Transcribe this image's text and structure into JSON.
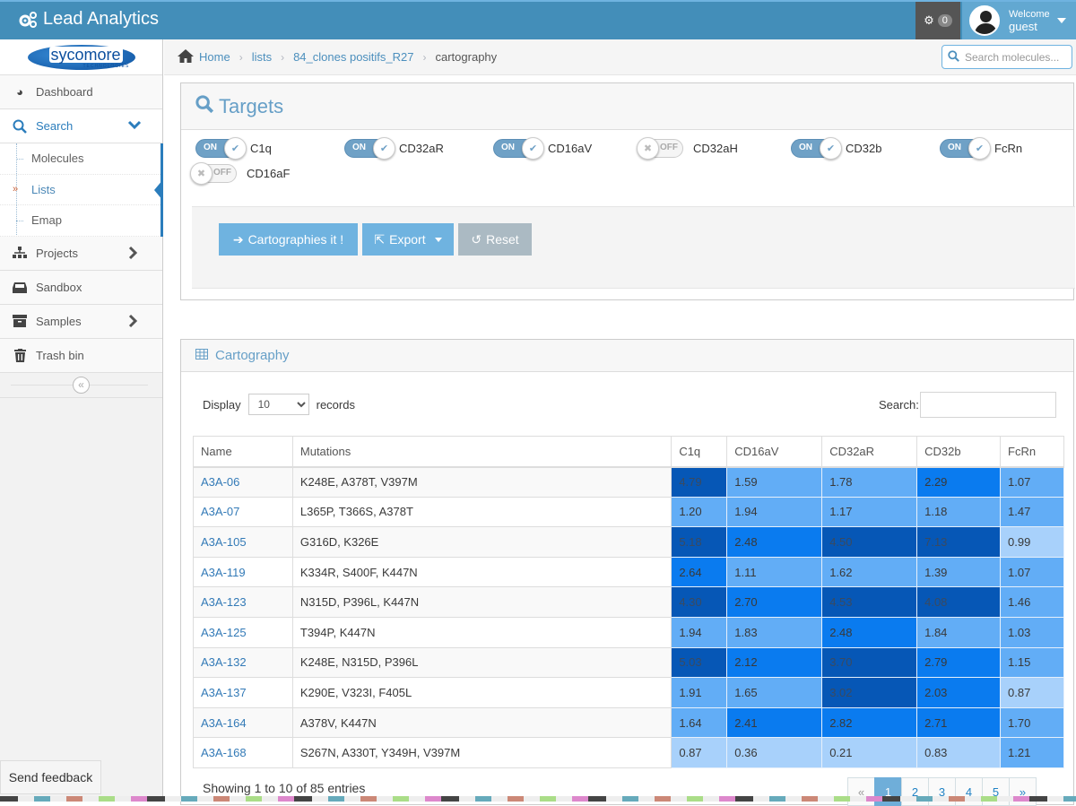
{
  "app": {
    "title": "Lead Analytics",
    "notifications_count": "0"
  },
  "user": {
    "welcome": "Welcome",
    "name": "guest"
  },
  "logo": {
    "text": "sycomore",
    "subtext": "TECHNOLOGIES"
  },
  "sidebar": {
    "items": [
      {
        "label": "Dashboard",
        "icon": "dashboard-icon"
      },
      {
        "label": "Search",
        "icon": "search-icon",
        "expanded": true
      },
      {
        "label": "Projects",
        "icon": "sitemap-icon"
      },
      {
        "label": "Sandbox",
        "icon": "inbox-icon"
      },
      {
        "label": "Samples",
        "icon": "archive-icon"
      },
      {
        "label": "Trash bin",
        "icon": "trash-icon"
      }
    ],
    "search_sub": [
      {
        "label": "Molecules"
      },
      {
        "label": "Lists",
        "active": true
      },
      {
        "label": "Emap"
      }
    ],
    "collapse_label": "«"
  },
  "breadcrumb": {
    "home": "Home",
    "lists": "lists",
    "list_name": "84_clones positifs_R27",
    "current": "cartography"
  },
  "nav_search": {
    "placeholder": "Search molecules..."
  },
  "targets": {
    "title": "Targets",
    "on_label": "ON",
    "off_label": "OFF",
    "items": [
      {
        "name": "C1q",
        "on": true
      },
      {
        "name": "CD32aR",
        "on": true
      },
      {
        "name": "CD16aV",
        "on": true
      },
      {
        "name": "CD32aH",
        "on": false
      },
      {
        "name": "CD32b",
        "on": true
      },
      {
        "name": "FcRn",
        "on": true
      },
      {
        "name": "CD16aF",
        "on": false
      }
    ],
    "buttons": {
      "cartography": "Cartographies it !",
      "export": "Export",
      "reset": "Reset"
    }
  },
  "cartography": {
    "title": "Cartography",
    "display_label": "Display",
    "records_label": "records",
    "page_length": "10",
    "search_label": "Search:",
    "search_value": "",
    "columns": [
      "Name",
      "Mutations",
      "C1q",
      "CD16aV",
      "CD32aR",
      "CD32b",
      "FcRn"
    ],
    "rows": [
      {
        "name": "A3A-06",
        "mutations": "K248E, A378T, V397M",
        "values": [
          "4.79",
          "1.59",
          "1.78",
          "2.29",
          "1.07"
        ]
      },
      {
        "name": "A3A-07",
        "mutations": "L365P, T366S, A378T",
        "values": [
          "1.20",
          "1.94",
          "1.17",
          "1.18",
          "1.47"
        ]
      },
      {
        "name": "A3A-105",
        "mutations": "G316D, K326E",
        "values": [
          "5.18",
          "2.48",
          "4.50",
          "7.13",
          "0.99"
        ]
      },
      {
        "name": "A3A-119",
        "mutations": "K334R, S400F, K447N",
        "values": [
          "2.64",
          "1.11",
          "1.62",
          "1.39",
          "1.07"
        ]
      },
      {
        "name": "A3A-123",
        "mutations": "N315D, P396L, K447N",
        "values": [
          "4.30",
          "2.70",
          "4.53",
          "4.08",
          "1.46"
        ]
      },
      {
        "name": "A3A-125",
        "mutations": "T394P, K447N",
        "values": [
          "1.94",
          "1.83",
          "2.48",
          "1.84",
          "1.03"
        ]
      },
      {
        "name": "A3A-132",
        "mutations": "K248E, N315D, P396L",
        "values": [
          "5.03",
          "2.12",
          "3.70",
          "2.79",
          "1.15"
        ]
      },
      {
        "name": "A3A-137",
        "mutations": "K290E, V323I, F405L",
        "values": [
          "1.91",
          "1.65",
          "3.02",
          "2.03",
          "0.87"
        ]
      },
      {
        "name": "A3A-164",
        "mutations": "A378V, K447N",
        "values": [
          "1.64",
          "2.41",
          "2.82",
          "2.71",
          "1.70"
        ]
      },
      {
        "name": "A3A-168",
        "mutations": "S267N, A330T, Y349H, V397M",
        "values": [
          "0.87",
          "0.36",
          "0.21",
          "0.83",
          "1.21"
        ]
      }
    ],
    "heat_colors": {
      "lt1": "#a8d1fb",
      "lt2": "#62adf6",
      "lt3": "#0a7bef",
      "ge3": "#0657b6"
    },
    "info": "Showing 1 to 10 of 85 entries",
    "pagination": {
      "prev": "«",
      "pages": [
        "1",
        "2",
        "3",
        "4",
        "5"
      ],
      "active": "1",
      "next": "»"
    }
  },
  "feedback": {
    "label": "Send feedback"
  }
}
